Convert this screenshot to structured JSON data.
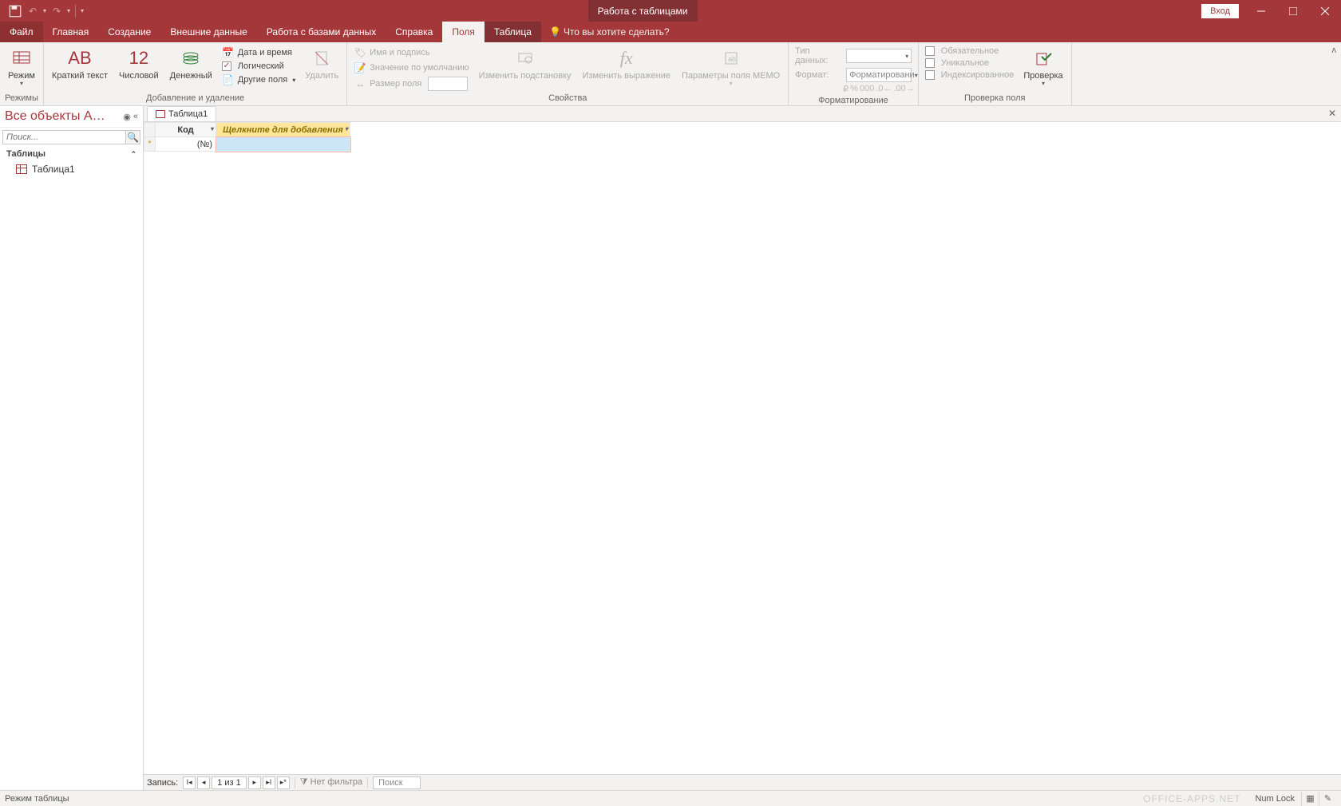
{
  "titlebar": {
    "context_title": "Работа с таблицами",
    "signin": "Вход"
  },
  "tabs": {
    "file": "Файл",
    "home": "Главная",
    "create": "Создание",
    "external": "Внешние данные",
    "dbtools": "Работа с базами данных",
    "help": "Справка",
    "fields": "Поля",
    "table": "Таблица",
    "tellme": "Что вы хотите сделать?"
  },
  "ribbon": {
    "modes_label": "Режимы",
    "view": "Режим",
    "shorttext": "Краткий текст",
    "number": "Числовой",
    "currency": "Денежный",
    "datetime": "Дата и время",
    "logical": "Логический",
    "morefields": "Другие поля",
    "add_delete": "Добавление и удаление",
    "delete": "Удалить",
    "name_caption": "Имя и подпись",
    "default_value": "Значение по умолчанию",
    "field_size": "Размер поля",
    "modify_lookups": "Изменить подстановку",
    "modify_expr": "Изменить выражение",
    "memo_settings": "Параметры поля MEMO",
    "properties": "Свойства",
    "datatype_lbl": "Тип данных:",
    "format_lbl": "Формат:",
    "format_ph": "Форматировани",
    "formatting": "Форматирование",
    "required": "Обязательное",
    "unique": "Уникальное",
    "indexed": "Индексированное",
    "validation": "Проверка",
    "field_validation": "Проверка поля"
  },
  "nav": {
    "title": "Все объекты A…",
    "search_ph": "Поиск...",
    "group_tables": "Таблицы",
    "item_table1": "Таблица1"
  },
  "doc": {
    "tab_name": "Таблица1",
    "col_id": "Код",
    "col_add": "Щелкните для добавления",
    "new_row_marker": "*",
    "cell_id": "(№)"
  },
  "recnav": {
    "label": "Запись:",
    "counter": "1 из 1",
    "no_filter": "Нет фильтра",
    "search": "Поиск"
  },
  "status": {
    "mode": "Режим таблицы",
    "numlock": "Num Lock",
    "watermark": "OFFICE-APPS.NET"
  }
}
